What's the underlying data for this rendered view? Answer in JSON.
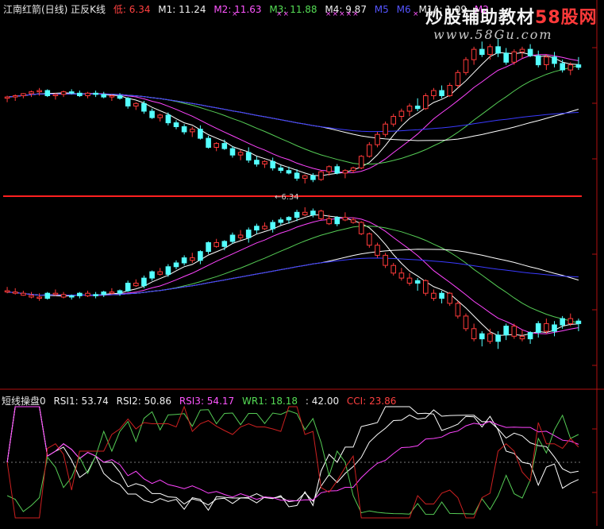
{
  "header": {
    "title": "江南红箭(日线) 正反K线",
    "low_label": "低: 6.34",
    "m1": "M1: 11.24",
    "m2": "M2: 11.63",
    "m3": "M3: 11.88",
    "m4": "M4: 9.87",
    "m5": "M5",
    "m6": "M6",
    "m1a": "M1A: 1.09",
    "m2a": "M2"
  },
  "cross_marks": [
    "×",
    "××",
    "×××××",
    "×"
  ],
  "low_marker": "6.34",
  "indicator": {
    "name": "短线操盘0",
    "rsi1": "RSI1: 53.74",
    "rsi2": "RSI2: 50.86",
    "rsi3": "RSI3: 54.17",
    "wr1": "WR1: 18.18",
    "v42": ": 42.00",
    "cci": "CCI: 23.86"
  },
  "watermark": {
    "text_cn": "炒股辅助教材",
    "brand": "58股网",
    "url": "www.58Gu.com"
  },
  "colors": {
    "background": "#000000",
    "up_candle": "#ff3a3a",
    "down_candle": "#54ffff",
    "ma_white": "#ffffff",
    "ma_magenta": "#ff44ff",
    "ma_green": "#55cc55",
    "ma_blue": "#3a3aff",
    "divider": "#b01010",
    "hline": "#ff2020"
  },
  "chart_data": {
    "type": "candlestick",
    "series_note": "upper half: price candles with moving averages; lower half: same candles mirrored (正反K线); bottom pane: oscillator lines",
    "low_value": 6.34,
    "candles": [
      [
        12.0,
        12.1,
        11.85,
        12.05
      ],
      [
        12.05,
        12.15,
        11.9,
        12.1
      ],
      [
        12.1,
        12.2,
        12.0,
        12.18
      ],
      [
        12.18,
        12.3,
        12.05,
        12.25
      ],
      [
        12.25,
        12.4,
        12.1,
        12.3
      ],
      [
        12.3,
        12.35,
        12.05,
        12.1
      ],
      [
        12.1,
        12.2,
        11.95,
        12.15
      ],
      [
        12.15,
        12.3,
        12.05,
        12.25
      ],
      [
        12.25,
        12.35,
        12.15,
        12.2
      ],
      [
        12.2,
        12.3,
        12.05,
        12.1
      ],
      [
        12.1,
        12.25,
        12.0,
        12.2
      ],
      [
        12.2,
        12.3,
        12.05,
        12.15
      ],
      [
        12.15,
        12.25,
        12.0,
        12.05
      ],
      [
        12.05,
        12.15,
        11.9,
        12.1
      ],
      [
        12.1,
        12.2,
        11.95,
        12.0
      ],
      [
        12.0,
        12.05,
        11.6,
        11.7
      ],
      [
        11.7,
        11.85,
        11.55,
        11.8
      ],
      [
        11.8,
        11.9,
        11.4,
        11.5
      ],
      [
        11.5,
        11.6,
        11.2,
        11.25
      ],
      [
        11.25,
        11.4,
        11.1,
        11.35
      ],
      [
        11.35,
        11.45,
        10.95,
        11.05
      ],
      [
        11.05,
        11.15,
        10.8,
        10.9
      ],
      [
        10.9,
        11.0,
        10.6,
        10.7
      ],
      [
        10.7,
        10.9,
        10.5,
        10.8
      ],
      [
        10.8,
        10.95,
        10.4,
        10.45
      ],
      [
        10.45,
        10.55,
        10.05,
        10.1
      ],
      [
        10.1,
        10.3,
        9.95,
        10.25
      ],
      [
        10.25,
        10.4,
        10.0,
        10.05
      ],
      [
        10.05,
        10.15,
        9.7,
        9.8
      ],
      [
        9.8,
        10.0,
        9.6,
        9.9
      ],
      [
        9.9,
        10.1,
        9.5,
        9.6
      ],
      [
        9.6,
        9.75,
        9.35,
        9.45
      ],
      [
        9.45,
        9.6,
        9.3,
        9.55
      ],
      [
        9.55,
        9.7,
        9.2,
        9.3
      ],
      [
        9.3,
        9.4,
        9.1,
        9.2
      ],
      [
        9.2,
        9.35,
        9.05,
        9.1
      ],
      [
        9.1,
        9.25,
        8.8,
        8.9
      ],
      [
        8.9,
        9.05,
        8.7,
        9.0
      ],
      [
        9.0,
        9.1,
        8.75,
        8.85
      ],
      [
        8.85,
        9.2,
        8.8,
        9.15
      ],
      [
        9.15,
        9.4,
        9.0,
        9.35
      ],
      [
        9.35,
        9.45,
        9.05,
        9.1
      ],
      [
        9.1,
        9.25,
        8.9,
        9.2
      ],
      [
        9.2,
        9.35,
        9.1,
        9.3
      ],
      [
        9.3,
        9.8,
        9.25,
        9.75
      ],
      [
        9.75,
        10.3,
        9.7,
        10.2
      ],
      [
        10.2,
        10.7,
        10.1,
        10.6
      ],
      [
        10.6,
        11.1,
        10.5,
        11.0
      ],
      [
        11.0,
        11.4,
        10.9,
        11.3
      ],
      [
        11.3,
        11.6,
        11.1,
        11.5
      ],
      [
        11.5,
        11.8,
        11.3,
        11.7
      ],
      [
        11.7,
        12.0,
        11.5,
        11.6
      ],
      [
        11.6,
        12.2,
        11.55,
        12.1
      ],
      [
        12.1,
        12.4,
        11.95,
        12.3
      ],
      [
        12.3,
        12.5,
        12.0,
        12.1
      ],
      [
        12.1,
        12.6,
        12.05,
        12.5
      ],
      [
        12.5,
        13.1,
        12.4,
        13.0
      ],
      [
        13.0,
        13.6,
        12.9,
        13.5
      ],
      [
        13.5,
        14.0,
        13.3,
        13.9
      ],
      [
        13.9,
        14.2,
        13.6,
        13.7
      ],
      [
        13.7,
        14.1,
        13.5,
        14.0
      ],
      [
        14.0,
        14.3,
        13.6,
        13.75
      ],
      [
        13.75,
        13.95,
        13.3,
        13.4
      ],
      [
        13.4,
        13.9,
        13.3,
        13.8
      ],
      [
        13.8,
        14.0,
        13.55,
        13.9
      ],
      [
        13.9,
        14.1,
        13.6,
        13.65
      ],
      [
        13.65,
        13.85,
        13.2,
        13.3
      ],
      [
        13.3,
        13.7,
        13.1,
        13.6
      ],
      [
        13.6,
        13.8,
        13.2,
        13.35
      ],
      [
        13.35,
        13.5,
        13.0,
        13.1
      ],
      [
        13.1,
        13.4,
        12.9,
        13.3
      ],
      [
        13.3,
        13.6,
        13.1,
        13.2
      ]
    ]
  }
}
